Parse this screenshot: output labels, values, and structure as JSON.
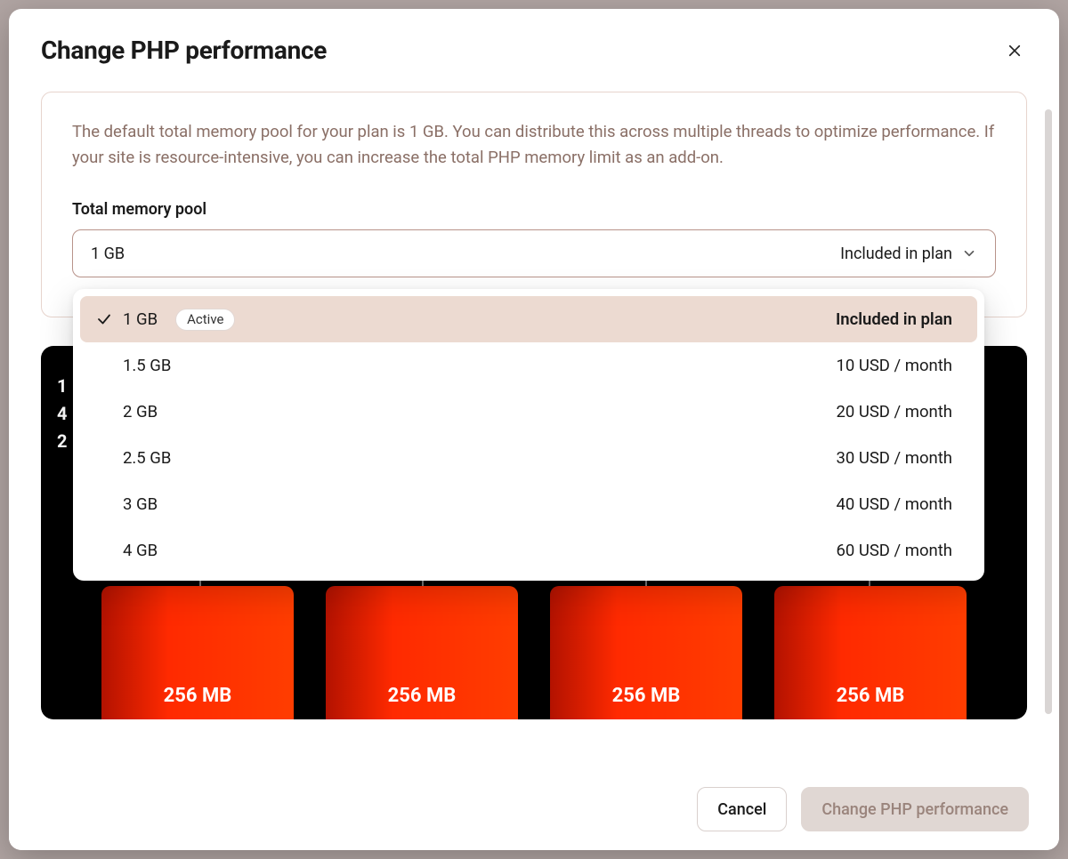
{
  "header": {
    "title": "Change PHP performance"
  },
  "info": {
    "text": "The default total memory pool for your plan is 1 GB. You can distribute this across multiple threads to optimize performance. If your site is resource-intensive, you can increase the total PHP memory limit as an add-on.",
    "field_label": "Total memory pool"
  },
  "select": {
    "value": "1 GB",
    "note": "Included in plan"
  },
  "options": [
    {
      "label": "1 GB",
      "price": "Included in plan",
      "active": true,
      "badge": "Active"
    },
    {
      "label": "1.5 GB",
      "price": "10 USD / month",
      "active": false
    },
    {
      "label": "2 GB",
      "price": "20 USD / month",
      "active": false
    },
    {
      "label": "2.5 GB",
      "price": "30 USD / month",
      "active": false
    },
    {
      "label": "3 GB",
      "price": "40 USD / month",
      "active": false
    },
    {
      "label": "4 GB",
      "price": "60 USD / month",
      "active": false
    }
  ],
  "diagram": {
    "meta_lines": [
      "1",
      "4",
      "2"
    ],
    "threads": [
      "256 MB",
      "256 MB",
      "256 MB",
      "256 MB"
    ]
  },
  "footer": {
    "cancel": "Cancel",
    "submit": "Change PHP performance"
  }
}
